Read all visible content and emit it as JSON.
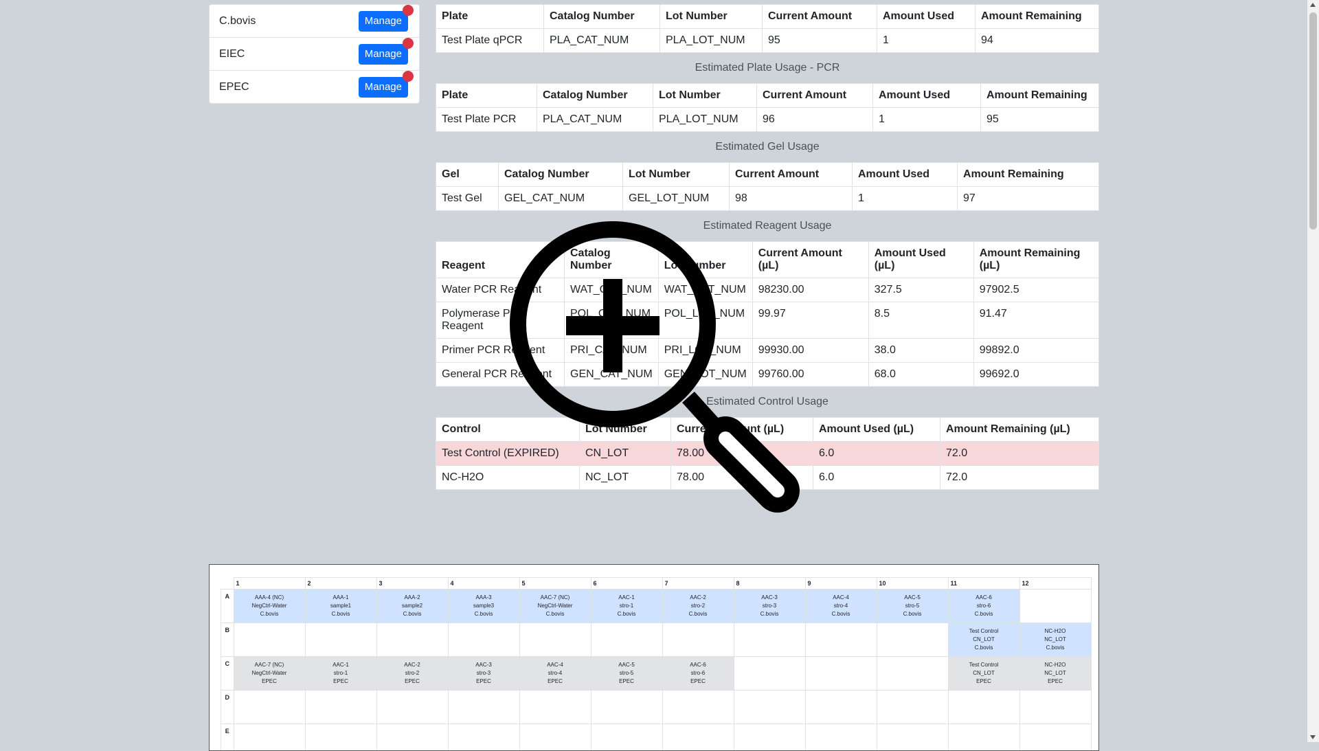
{
  "sidebar": {
    "items": [
      {
        "label": "C.bovis",
        "button": "Manage"
      },
      {
        "label": "EIEC",
        "button": "Manage"
      },
      {
        "label": "EPEC",
        "button": "Manage"
      }
    ]
  },
  "qpcr_table": {
    "headers": [
      "Plate",
      "Catalog Number",
      "Lot Number",
      "Current Amount",
      "Amount Used",
      "Amount Remaining"
    ],
    "rows": [
      [
        "Test Plate qPCR",
        "PLA_CAT_NUM",
        "PLA_LOT_NUM",
        "95",
        "1",
        "94"
      ]
    ]
  },
  "pcr_plate": {
    "caption": "Estimated Plate Usage - PCR",
    "headers": [
      "Plate",
      "Catalog Number",
      "Lot Number",
      "Current Amount",
      "Amount Used",
      "Amount Remaining"
    ],
    "rows": [
      [
        "Test Plate PCR",
        "PLA_CAT_NUM",
        "PLA_LOT_NUM",
        "96",
        "1",
        "95"
      ]
    ]
  },
  "gel": {
    "caption": "Estimated Gel Usage",
    "headers": [
      "Gel",
      "Catalog Number",
      "Lot Number",
      "Current Amount",
      "Amount Used",
      "Amount Remaining"
    ],
    "rows": [
      [
        "Test Gel",
        "GEL_CAT_NUM",
        "GEL_LOT_NUM",
        "98",
        "1",
        "97"
      ]
    ]
  },
  "reagent": {
    "caption": "Estimated Reagent Usage",
    "headers": [
      "Reagent",
      "Catalog Number",
      "Lot Number",
      "Current Amount (µL)",
      "Amount Used (µL)",
      "Amount Remaining (µL)"
    ],
    "rows": [
      [
        "Water PCR Reagent",
        "WAT_CAT_NUM",
        "WAT_LOT_NUM",
        "98230.00",
        "327.5",
        "97902.5"
      ],
      [
        "Polymerase PCR Reagent",
        "POL_CAT_NUM",
        "POL_LOT_NUM",
        "99.97",
        "8.5",
        "91.47"
      ],
      [
        "Primer PCR Reagent",
        "PRI_CAT_NUM",
        "PRI_LOT_NUM",
        "99930.00",
        "38.0",
        "99892.0"
      ],
      [
        "General PCR Reagent",
        "GEN_CAT_NUM",
        "GEN_LOT_NUM",
        "99760.00",
        "68.0",
        "99692.0"
      ]
    ]
  },
  "control": {
    "caption": "Estimated Control Usage",
    "headers": [
      "Control",
      "Lot Number",
      "Current Amount (µL)",
      "Amount Used (µL)",
      "Amount Remaining (µL)"
    ],
    "rows": [
      {
        "cells": [
          "Test Control (EXPIRED)",
          "CN_LOT",
          "78.00",
          "6.0",
          "72.0"
        ],
        "expired": true
      },
      {
        "cells": [
          "NC-H2O",
          "NC_LOT",
          "78.00",
          "6.0",
          "72.0"
        ],
        "expired": false
      }
    ]
  },
  "plate_map": {
    "columns": [
      "1",
      "2",
      "3",
      "4",
      "5",
      "6",
      "7",
      "8",
      "9",
      "10",
      "11",
      "12"
    ],
    "rows": [
      {
        "label": "A",
        "wells": [
          {
            "lines": [
              "AAA-4 (NC)",
              "NegCtrl-Water",
              "C.bovis"
            ],
            "color": "blue"
          },
          {
            "lines": [
              "AAA-1",
              "sample1",
              "C.bovis"
            ],
            "color": "blue"
          },
          {
            "lines": [
              "AAA-2",
              "sample2",
              "C.bovis"
            ],
            "color": "blue"
          },
          {
            "lines": [
              "AAA-3",
              "sample3",
              "C.bovis"
            ],
            "color": "blue"
          },
          {
            "lines": [
              "AAC-7 (NC)",
              "NegCtrl-Water",
              "C.bovis"
            ],
            "color": "blue"
          },
          {
            "lines": [
              "AAC-1",
              "stro-1",
              "C.bovis"
            ],
            "color": "blue"
          },
          {
            "lines": [
              "AAC-2",
              "stro-2",
              "C.bovis"
            ],
            "color": "blue"
          },
          {
            "lines": [
              "AAC-3",
              "stro-3",
              "C.bovis"
            ],
            "color": "blue"
          },
          {
            "lines": [
              "AAC-4",
              "stro-4",
              "C.bovis"
            ],
            "color": "blue"
          },
          {
            "lines": [
              "AAC-5",
              "stro-5",
              "C.bovis"
            ],
            "color": "blue"
          },
          {
            "lines": [
              "AAC-6",
              "stro-6",
              "C.bovis"
            ],
            "color": "blue"
          },
          {
            "lines": [],
            "color": ""
          }
        ]
      },
      {
        "label": "B",
        "wells": [
          {
            "lines": [],
            "color": ""
          },
          {
            "lines": [],
            "color": ""
          },
          {
            "lines": [],
            "color": ""
          },
          {
            "lines": [],
            "color": ""
          },
          {
            "lines": [],
            "color": ""
          },
          {
            "lines": [],
            "color": ""
          },
          {
            "lines": [],
            "color": ""
          },
          {
            "lines": [],
            "color": ""
          },
          {
            "lines": [],
            "color": ""
          },
          {
            "lines": [],
            "color": ""
          },
          {
            "lines": [
              "Test Control",
              "CN_LOT",
              "C.bovis"
            ],
            "color": "blue"
          },
          {
            "lines": [
              "NC-H2O",
              "NC_LOT",
              "C.bovis"
            ],
            "color": "blue"
          }
        ]
      },
      {
        "label": "C",
        "wells": [
          {
            "lines": [
              "AAC-7 (NC)",
              "NegCtrl-Water",
              "EPEC"
            ],
            "color": "gray"
          },
          {
            "lines": [
              "AAC-1",
              "stro-1",
              "EPEC"
            ],
            "color": "gray"
          },
          {
            "lines": [
              "AAC-2",
              "stro-2",
              "EPEC"
            ],
            "color": "gray"
          },
          {
            "lines": [
              "AAC-3",
              "stro-3",
              "EPEC"
            ],
            "color": "gray"
          },
          {
            "lines": [
              "AAC-4",
              "stro-4",
              "EPEC"
            ],
            "color": "gray"
          },
          {
            "lines": [
              "AAC-5",
              "stro-5",
              "EPEC"
            ],
            "color": "gray"
          },
          {
            "lines": [
              "AAC-6",
              "stro-6",
              "EPEC"
            ],
            "color": "gray"
          },
          {
            "lines": [],
            "color": ""
          },
          {
            "lines": [],
            "color": ""
          },
          {
            "lines": [],
            "color": ""
          },
          {
            "lines": [
              "Test Control",
              "CN_LOT",
              "EPEC"
            ],
            "color": "gray"
          },
          {
            "lines": [
              "NC-H2O",
              "NC_LOT",
              "EPEC"
            ],
            "color": "gray"
          }
        ]
      },
      {
        "label": "D",
        "wells": [
          {
            "lines": [],
            "color": ""
          },
          {
            "lines": [],
            "color": ""
          },
          {
            "lines": [],
            "color": ""
          },
          {
            "lines": [],
            "color": ""
          },
          {
            "lines": [],
            "color": ""
          },
          {
            "lines": [],
            "color": ""
          },
          {
            "lines": [],
            "color": ""
          },
          {
            "lines": [],
            "color": ""
          },
          {
            "lines": [],
            "color": ""
          },
          {
            "lines": [],
            "color": ""
          },
          {
            "lines": [],
            "color": ""
          },
          {
            "lines": [],
            "color": ""
          }
        ]
      },
      {
        "label": "E",
        "wells": [
          {
            "lines": [],
            "color": ""
          },
          {
            "lines": [],
            "color": ""
          },
          {
            "lines": [],
            "color": ""
          },
          {
            "lines": [],
            "color": ""
          },
          {
            "lines": [],
            "color": ""
          },
          {
            "lines": [],
            "color": ""
          },
          {
            "lines": [],
            "color": ""
          },
          {
            "lines": [],
            "color": ""
          },
          {
            "lines": [],
            "color": ""
          },
          {
            "lines": [],
            "color": ""
          },
          {
            "lines": [],
            "color": ""
          },
          {
            "lines": [],
            "color": ""
          }
        ]
      }
    ]
  },
  "colors": {
    "well_blue": "#cfe2ff",
    "well_gray": "#e2e3e5",
    "expired_row": "#f8d7da",
    "button": "#0d6efd",
    "notification_dot": "#dc3545"
  },
  "cursor": {
    "icon": "zoom-in-icon"
  }
}
